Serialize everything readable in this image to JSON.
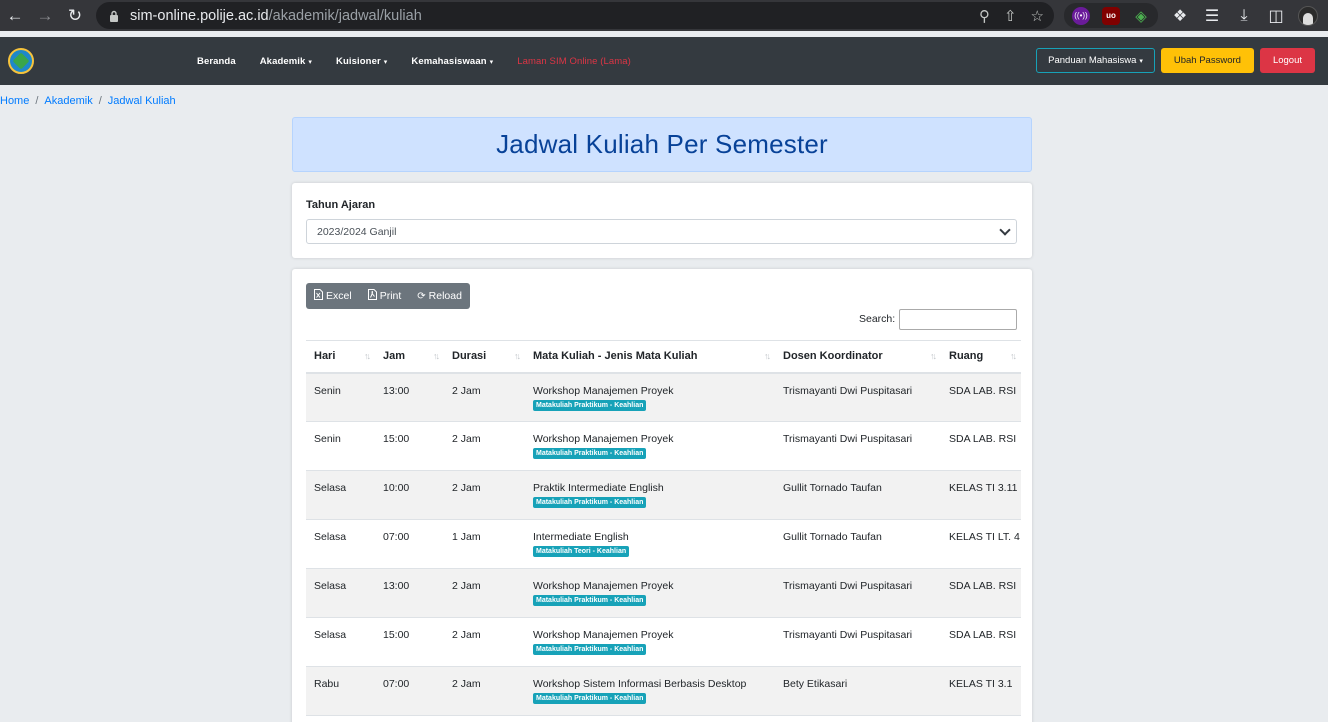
{
  "browser": {
    "url_host": "sim-online.polije.ac.id",
    "url_path": "/akademik/jadwal/kuliah"
  },
  "navbar": {
    "menu": [
      {
        "label": "Beranda",
        "dropdown": false
      },
      {
        "label": "Akademik",
        "dropdown": true
      },
      {
        "label": "Kuisioner",
        "dropdown": true
      },
      {
        "label": "Kemahasiswaan",
        "dropdown": true
      },
      {
        "label": "Laman SIM Online (Lama)",
        "dropdown": false
      }
    ],
    "panduan": "Panduan Mahasiswa",
    "ubah_password": "Ubah Password",
    "logout": "Logout"
  },
  "breadcrumb": [
    "Home",
    "Akademik",
    "Jadwal Kuliah"
  ],
  "title": "Jadwal Kuliah Per Semester",
  "filter": {
    "label": "Tahun Ajaran",
    "value": "2023/2024 Ganjil"
  },
  "toolbar": {
    "excel": "Excel",
    "print": "Print",
    "reload": "Reload",
    "search_label": "Search:"
  },
  "table": {
    "headers": [
      "Hari",
      "Jam",
      "Durasi",
      "Mata Kuliah - Jenis Mata Kuliah",
      "Dosen Koordinator",
      "Ruang"
    ],
    "rows": [
      {
        "hari": "Senin",
        "jam": "13:00",
        "durasi": "2 Jam",
        "matkul": "Workshop Manajemen Proyek",
        "jenis": "Matakuliah Praktikum - Keahlian",
        "dosen": "Trismayanti Dwi Puspitasari",
        "ruang": "SDA LAB. RSI"
      },
      {
        "hari": "Senin",
        "jam": "15:00",
        "durasi": "2 Jam",
        "matkul": "Workshop Manajemen Proyek",
        "jenis": "Matakuliah Praktikum - Keahlian",
        "dosen": "Trismayanti Dwi Puspitasari",
        "ruang": "SDA LAB. RSI"
      },
      {
        "hari": "Selasa",
        "jam": "10:00",
        "durasi": "2 Jam",
        "matkul": "Praktik Intermediate English",
        "jenis": "Matakuliah Praktikum - Keahlian",
        "dosen": "Gullit Tornado Taufan",
        "ruang": "KELAS TI 3.11"
      },
      {
        "hari": "Selasa",
        "jam": "07:00",
        "durasi": "1 Jam",
        "matkul": "Intermediate English",
        "jenis": "Matakuliah Teori - Keahlian",
        "dosen": "Gullit Tornado Taufan",
        "ruang": "KELAS TI LT. 4"
      },
      {
        "hari": "Selasa",
        "jam": "13:00",
        "durasi": "2 Jam",
        "matkul": "Workshop Manajemen Proyek",
        "jenis": "Matakuliah Praktikum - Keahlian",
        "dosen": "Trismayanti Dwi Puspitasari",
        "ruang": "SDA LAB. RSI"
      },
      {
        "hari": "Selasa",
        "jam": "15:00",
        "durasi": "2 Jam",
        "matkul": "Workshop Manajemen Proyek",
        "jenis": "Matakuliah Praktikum - Keahlian",
        "dosen": "Trismayanti Dwi Puspitasari",
        "ruang": "SDA LAB. RSI"
      },
      {
        "hari": "Rabu",
        "jam": "07:00",
        "durasi": "2 Jam",
        "matkul": "Workshop Sistem Informasi Berbasis Desktop",
        "jenis": "Matakuliah Praktikum - Keahlian",
        "dosen": "Bety Etikasari",
        "ruang": "KELAS TI 3.1"
      }
    ]
  }
}
